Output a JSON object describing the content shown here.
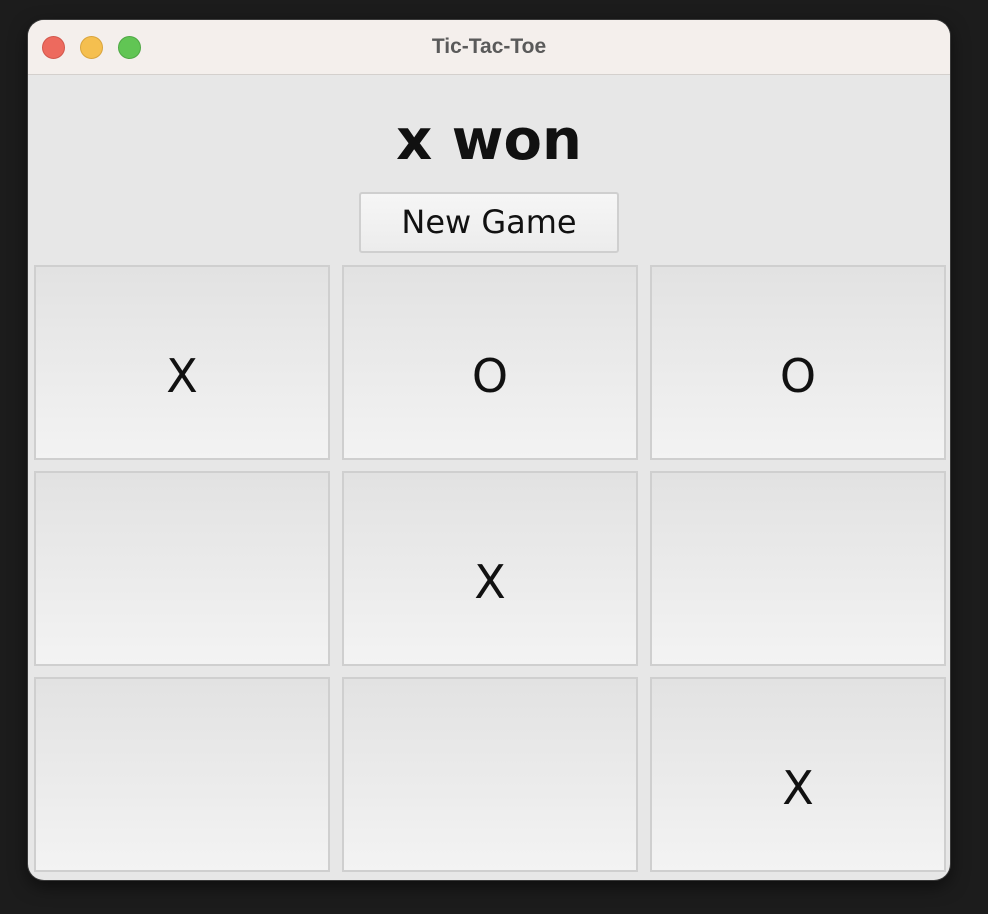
{
  "window": {
    "title": "Tic-Tac-Toe"
  },
  "game": {
    "status": "x won",
    "new_game_label": "New Game",
    "board": [
      [
        "X",
        "O",
        "O"
      ],
      [
        "",
        "X",
        ""
      ],
      [
        "",
        "",
        "X"
      ]
    ]
  },
  "colors": {
    "close": "#ed6a5e",
    "minimize": "#f5bf4f",
    "zoom": "#61c554"
  }
}
